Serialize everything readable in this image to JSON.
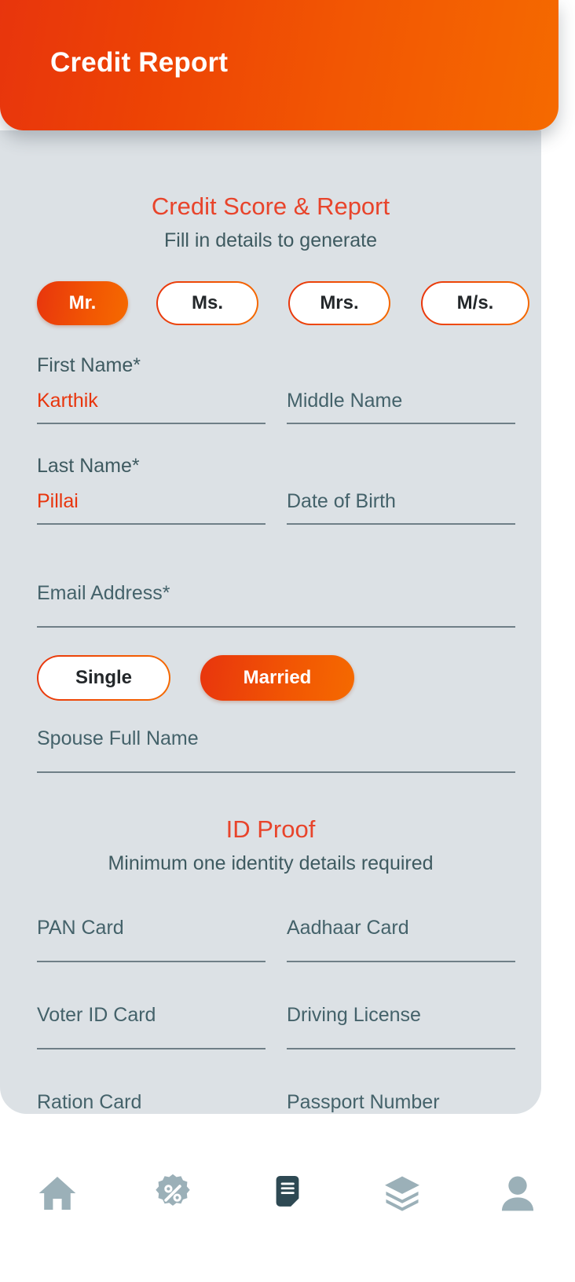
{
  "header": {
    "title": "Credit Report"
  },
  "section": {
    "title": "Credit Score & Report",
    "subtitle": "Fill in details to generate"
  },
  "salutation": {
    "options": [
      {
        "label": "Mr.",
        "selected": true
      },
      {
        "label": "Ms.",
        "selected": false
      },
      {
        "label": "Mrs.",
        "selected": false
      },
      {
        "label": "M/s.",
        "selected": false
      }
    ]
  },
  "form": {
    "first_name": {
      "label": "First Name*",
      "value": "Karthik",
      "placeholder": "First Name*"
    },
    "middle_name": {
      "label": "Middle Name",
      "value": "",
      "placeholder": "Middle Name"
    },
    "last_name": {
      "label": "Last Name*",
      "value": "Pillai",
      "placeholder": "Last Name*"
    },
    "date_of_birth": {
      "label": "Date of Birth",
      "value": "",
      "placeholder": "Date of Birth"
    },
    "email": {
      "label": "Email Address*",
      "value": "",
      "placeholder": "Email Address*"
    },
    "spouse_name": {
      "label": "Spouse Full Name",
      "value": "",
      "placeholder": "Spouse Full Name"
    }
  },
  "marital_status": {
    "options": [
      {
        "label": "Single",
        "selected": false
      },
      {
        "label": "Married",
        "selected": true
      }
    ]
  },
  "id_proof": {
    "title": "ID Proof",
    "subtitle": "Minimum one identity details required",
    "fields": [
      {
        "placeholder": "PAN Card",
        "value": ""
      },
      {
        "placeholder": "Aadhaar Card",
        "value": ""
      },
      {
        "placeholder": "Voter ID Card",
        "value": ""
      },
      {
        "placeholder": "Driving License",
        "value": ""
      },
      {
        "placeholder": "Ration Card",
        "value": ""
      },
      {
        "placeholder": "Passport Number",
        "value": ""
      }
    ]
  },
  "bottom_nav": {
    "items": [
      {
        "icon": "home-icon",
        "active": false
      },
      {
        "icon": "percent-badge-icon",
        "active": false
      },
      {
        "icon": "document-icon",
        "active": true
      },
      {
        "icon": "layers-icon",
        "active": false
      },
      {
        "icon": "person-icon",
        "active": false
      }
    ]
  },
  "colors": {
    "brand_start": "#E8350D",
    "brand_end": "#F56A00",
    "accent_text": "#E8442B",
    "body_text": "#3E5A60",
    "card_bg": "#DCE1E5",
    "nav_inactive": "#9BB0B8",
    "nav_active": "#2E4953"
  }
}
